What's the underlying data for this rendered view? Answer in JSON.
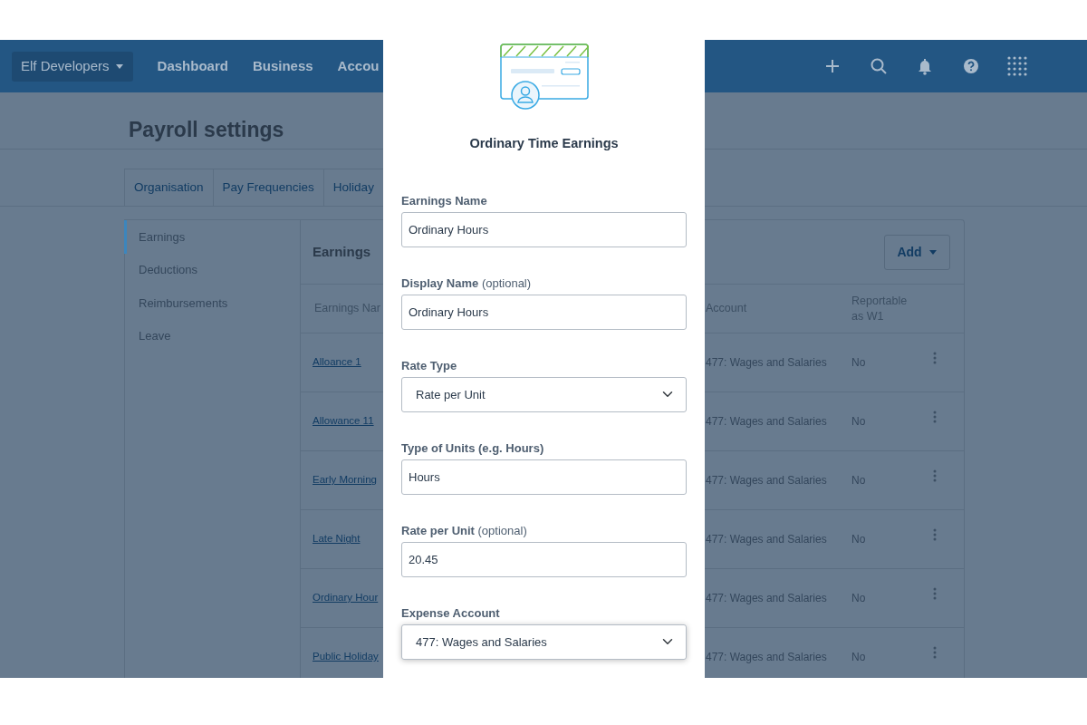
{
  "navbar": {
    "org_switcher": "Elf Developers",
    "links": [
      "Dashboard",
      "Business",
      "Accou"
    ]
  },
  "page": {
    "title": "Payroll settings"
  },
  "tabs": [
    {
      "label": "Organisation",
      "selected": false
    },
    {
      "label": "Pay Frequencies",
      "selected": false
    },
    {
      "label": "Holiday",
      "selected": false
    }
  ],
  "sidebar": {
    "items": [
      {
        "label": "Earnings",
        "selected": true
      },
      {
        "label": "Deductions",
        "selected": false
      },
      {
        "label": "Reimbursements",
        "selected": false
      },
      {
        "label": "Leave",
        "selected": false
      }
    ]
  },
  "earnings_table": {
    "title": "Earnings",
    "add_button": "Add",
    "columns": [
      "Earnings Nar",
      "Account",
      "Reportable as W1"
    ],
    "rows": [
      {
        "name": "Alloance 1",
        "account": "477: Wages and Salaries",
        "reportable": "No"
      },
      {
        "name": "Allowance 11",
        "account": "477: Wages and Salaries",
        "reportable": "No"
      },
      {
        "name": "Early Morning",
        "account": "477: Wages and Salaries",
        "reportable": "No"
      },
      {
        "name": "Late Night",
        "account": "477: Wages and Salaries",
        "reportable": "No"
      },
      {
        "name": "Ordinary Hour",
        "account": "477: Wages and Salaries",
        "reportable": "No"
      },
      {
        "name": "Public Holiday",
        "account": "477: Wages and Salaries",
        "reportable": "No"
      }
    ]
  },
  "modal": {
    "title": "Ordinary Time Earnings",
    "fields": [
      {
        "kind": "text",
        "label": "Earnings Name",
        "value": "Ordinary Hours",
        "focused": false
      },
      {
        "kind": "text",
        "label": "Display Name",
        "note": "(optional)",
        "value": "Ordinary Hours",
        "focused": false
      },
      {
        "kind": "select",
        "label": "Rate Type",
        "value": "Rate per Unit",
        "focused": false
      },
      {
        "kind": "text",
        "label": "Type of Units (e.g. Hours)",
        "value": "Hours",
        "focused": false
      },
      {
        "kind": "text",
        "label": "Rate per Unit",
        "note": "(optional)",
        "value": "20.45",
        "focused": false
      },
      {
        "kind": "select",
        "label": "Expense Account",
        "value": "477: Wages and Salaries",
        "focused": true
      }
    ]
  }
}
